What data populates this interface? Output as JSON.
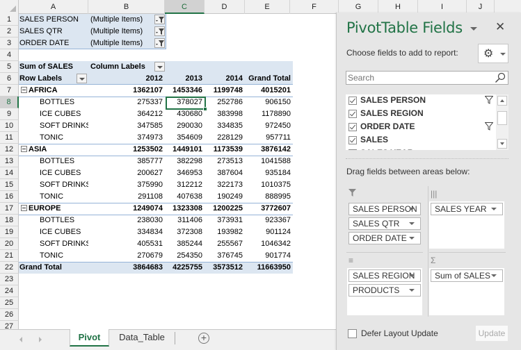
{
  "sheet": {
    "columns": [
      "A",
      "B",
      "C",
      "D",
      "E",
      "F",
      "G",
      "H",
      "I",
      "J"
    ],
    "selected_column": "C",
    "rows": [
      "1",
      "2",
      "3",
      "4",
      "5",
      "6",
      "7",
      "8",
      "9",
      "10",
      "11",
      "12",
      "13",
      "14",
      "15",
      "16",
      "17",
      "18",
      "19",
      "20",
      "21",
      "22",
      "23",
      "24",
      "25",
      "26",
      "27"
    ],
    "selected_row": "8",
    "selected_cell": "C8"
  },
  "pivot": {
    "filters": [
      {
        "field": "SALES PERSON",
        "value": "(Multiple Items)"
      },
      {
        "field": "SALES QTR",
        "value": "(Multiple Items)"
      },
      {
        "field": "ORDER DATE",
        "value": "(Multiple Items)"
      }
    ],
    "values_label": "Sum of SALES",
    "column_labels": "Column Labels",
    "row_labels": "Row Labels",
    "years": [
      "2012",
      "2013",
      "2014"
    ],
    "grand_total_label": "Grand Total",
    "regions": [
      {
        "name": "AFRICA",
        "totals": [
          "1362107",
          "1453346",
          "1199748",
          "4015201"
        ],
        "products": [
          {
            "name": "BOTTLES",
            "values": [
              "275337",
              "378027",
              "252786",
              "906150"
            ]
          },
          {
            "name": "ICE CUBES",
            "values": [
              "364212",
              "430680",
              "383998",
              "1178890"
            ]
          },
          {
            "name": "SOFT DRINKS",
            "values": [
              "347585",
              "290030",
              "334835",
              "972450"
            ]
          },
          {
            "name": "TONIC",
            "values": [
              "374973",
              "354609",
              "228129",
              "957711"
            ]
          }
        ]
      },
      {
        "name": "ASIA",
        "totals": [
          "1253502",
          "1449101",
          "1173539",
          "3876142"
        ],
        "products": [
          {
            "name": "BOTTLES",
            "values": [
              "385777",
              "382298",
              "273513",
              "1041588"
            ]
          },
          {
            "name": "ICE CUBES",
            "values": [
              "200627",
              "346953",
              "387604",
              "935184"
            ]
          },
          {
            "name": "SOFT DRINKS",
            "values": [
              "375990",
              "312212",
              "322173",
              "1010375"
            ]
          },
          {
            "name": "TONIC",
            "values": [
              "291108",
              "407638",
              "190249",
              "888995"
            ]
          }
        ]
      },
      {
        "name": "EUROPE",
        "totals": [
          "1249074",
          "1323308",
          "1200225",
          "3772607"
        ],
        "products": [
          {
            "name": "BOTTLES",
            "values": [
              "238030",
              "311406",
              "373931",
              "923367"
            ]
          },
          {
            "name": "ICE CUBES",
            "values": [
              "334834",
              "372308",
              "193982",
              "901124"
            ]
          },
          {
            "name": "SOFT DRINKS",
            "values": [
              "405531",
              "385244",
              "255567",
              "1046342"
            ]
          },
          {
            "name": "TONIC",
            "values": [
              "270679",
              "254350",
              "376745",
              "901774"
            ]
          }
        ]
      }
    ],
    "grand_totals": [
      "3864683",
      "4225755",
      "3573512",
      "11663950"
    ]
  },
  "tabs": {
    "items": [
      {
        "label": "Pivot",
        "active": true
      },
      {
        "label": "Data_Table",
        "active": false
      }
    ],
    "add_icon": "plus-circle-icon"
  },
  "pane": {
    "title": "PivotTable Fields",
    "choose_label": "Choose fields to add to report:",
    "search_placeholder": "Search",
    "fields": [
      {
        "label": "SALES PERSON",
        "checked": true,
        "filtered": true
      },
      {
        "label": "SALES REGION",
        "checked": true,
        "filtered": false
      },
      {
        "label": "ORDER DATE",
        "checked": true,
        "filtered": true
      },
      {
        "label": "SALES",
        "checked": true,
        "filtered": false
      },
      {
        "label": "SALES YEAR",
        "checked": true,
        "filtered": false
      }
    ],
    "drag_label": "Drag fields between areas below:",
    "areas": {
      "filters": {
        "title": "Filters",
        "items": [
          "SALES PERSON",
          "SALES QTR",
          "ORDER DATE"
        ]
      },
      "columns": {
        "title": "Columns",
        "items": [
          "SALES YEAR"
        ]
      },
      "rows": {
        "title": "Rows",
        "items": [
          "SALES REGION",
          "PRODUCTS"
        ]
      },
      "values": {
        "title": "Values",
        "items": [
          "Sum of SALES"
        ]
      }
    },
    "defer_label": "Defer Layout Update",
    "defer_checked": false,
    "update_label": "Update"
  },
  "colors": {
    "accent": "#217346",
    "pivot_header_bg": "#dce6f1",
    "pivot_line": "#95b3d7",
    "pane_bg": "#e6e6e6"
  }
}
